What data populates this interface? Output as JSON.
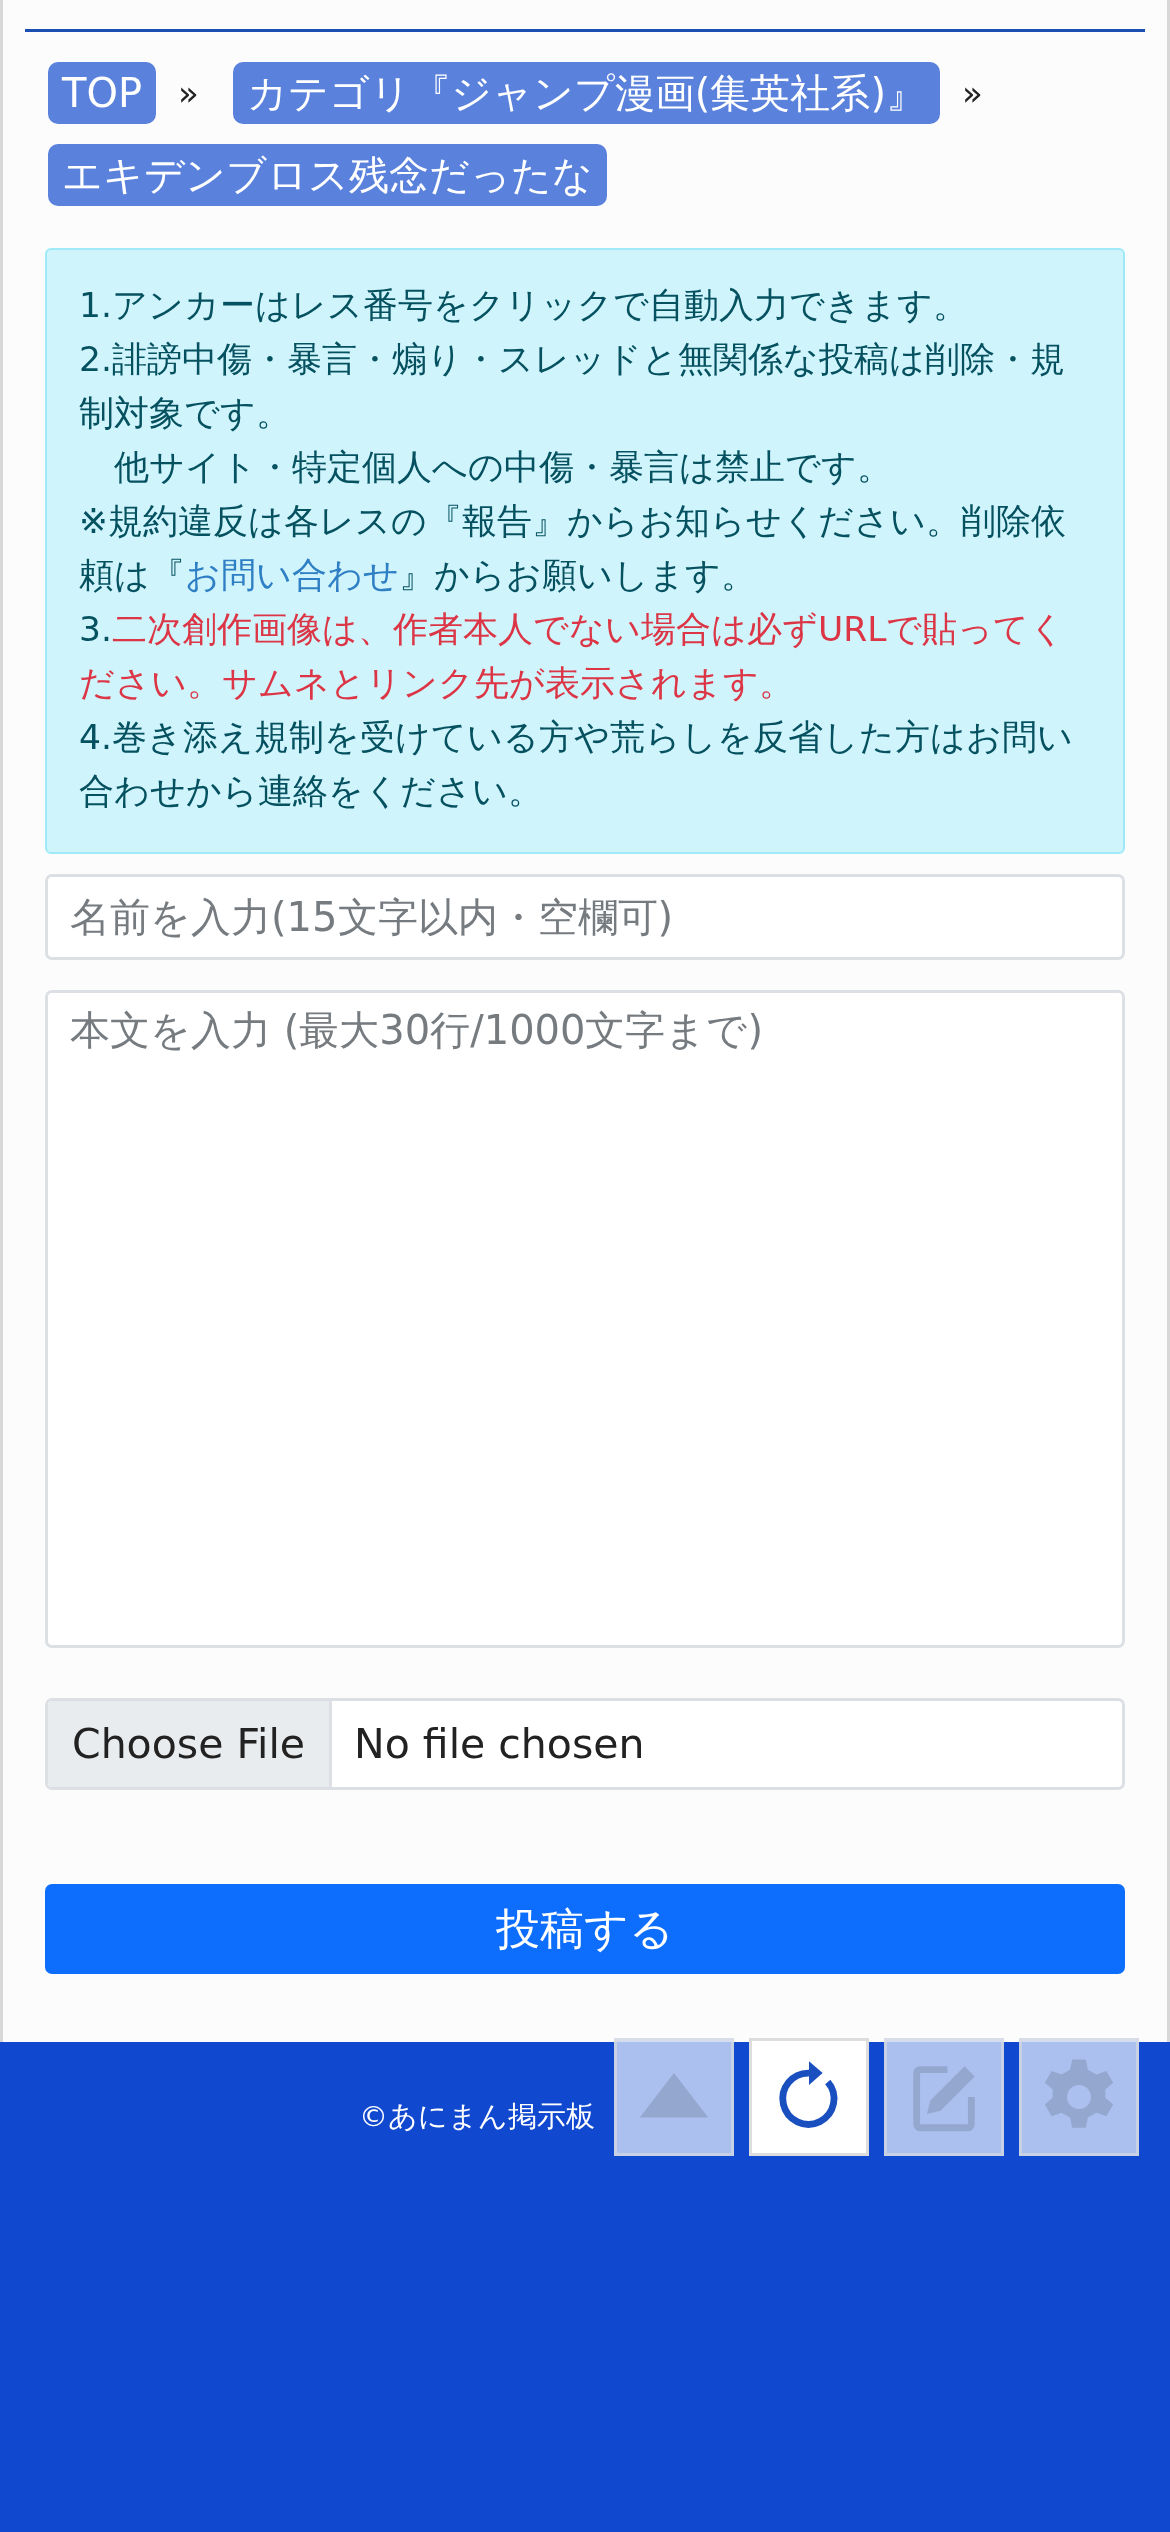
{
  "breadcrumb": [
    {
      "label": "TOP",
      "separator": "»"
    },
    {
      "label": "カテゴリ『ジャンプ漫画(集英社系)』",
      "separator": "»"
    },
    {
      "label": "エキデンブロス残念だったな"
    }
  ],
  "notice": {
    "paragraphs": [
      [
        {
          "kind": "text",
          "text": "1.アンカーはレス番号をクリックで自動入力できます。"
        }
      ],
      [
        {
          "kind": "text",
          "text": "2.誹謗中傷・暴言・煽り・スレッドと無関係な投稿は削除・規制対象です。"
        }
      ],
      [
        {
          "kind": "text",
          "text": "　他サイト・特定個人への中傷・暴言は禁止です。"
        }
      ],
      [
        {
          "kind": "text",
          "text": "※規約違反は各レスの『報告』からお知らせください。削除依頼は『"
        },
        {
          "kind": "link",
          "text": "お問い合わせ"
        },
        {
          "kind": "text",
          "text": "』からお願いします。"
        }
      ],
      [
        {
          "kind": "text",
          "text": "3."
        },
        {
          "kind": "alert",
          "text": "二次創作画像は、作者本人でない場合は必ずURLで貼ってください。サムネとリンク先が表示されます。"
        }
      ],
      [
        {
          "kind": "text",
          "text": "4.巻き添え規制を受けている方や荒らしを反省した方はお問い合わせから連絡をください。"
        }
      ]
    ]
  },
  "form": {
    "name_field": {
      "placeholder": "名前を入力(15文字以内・空欄可)"
    },
    "body_field": {
      "placeholder": "本文を入力 (最大30行/1000文字まで)"
    },
    "file_button": "Choose File",
    "file_status": "No file chosen",
    "submit": "投稿する"
  },
  "footer": {
    "copyright": "©あにまん掲示板"
  },
  "floating_buttons": [
    {
      "kind": "up",
      "active": false
    },
    {
      "kind": "reload",
      "active": true
    },
    {
      "kind": "edit",
      "active": false
    },
    {
      "kind": "settings",
      "active": false
    }
  ]
}
